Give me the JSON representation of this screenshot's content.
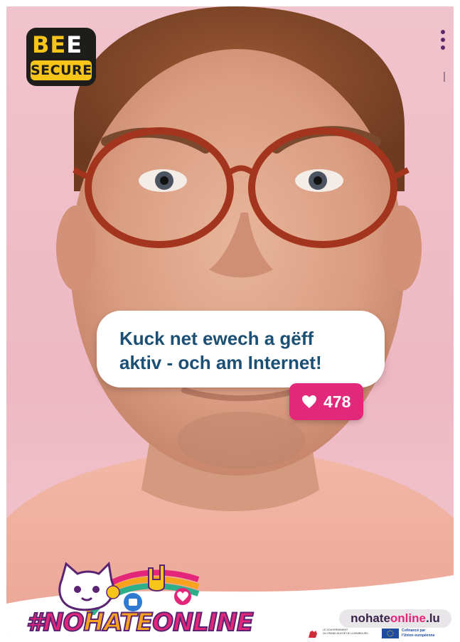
{
  "brand": {
    "logo_line1_part1": "BE",
    "logo_line1_part2": "E",
    "logo_line2": "SECURE"
  },
  "bubble": {
    "text_line1": "Kuck net ewech a gëff",
    "text_line2": "aktiv - och am Internet!"
  },
  "likes": {
    "count": "478"
  },
  "campaign": {
    "hashtag_part1": "#NO",
    "hashtag_part2": "HATE",
    "hashtag_part3": "ONLINE",
    "url_part1": "nohate",
    "url_part2": "online",
    "url_part3": ".lu"
  },
  "footer": {
    "gov_line1": "LE GOUVERNEMENT",
    "gov_line2": "DU GRAND-DUCHÉ DE LUXEMBOURG",
    "eu_line1": "Cofinancé par",
    "eu_line2": "l'Union européenne"
  },
  "colors": {
    "background_pink": "#f0c4cd",
    "brand_yellow": "#f7c419",
    "bubble_text": "#1b4f73",
    "like_pink": "#e2287a",
    "hashtag_pink": "#e4267a",
    "eu_blue": "#1f4ca3"
  }
}
